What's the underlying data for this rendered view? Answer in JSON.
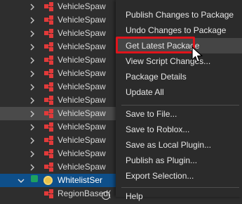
{
  "tree": {
    "items": [
      {
        "label": "VehicleSpaw",
        "icon": "package-icon",
        "state": "normal"
      },
      {
        "label": "VehicleSpaw",
        "icon": "package-icon",
        "state": "normal"
      },
      {
        "label": "VehicleSpaw",
        "icon": "package-icon",
        "state": "normal"
      },
      {
        "label": "VehicleSpaw",
        "icon": "package-icon",
        "state": "normal"
      },
      {
        "label": "VehicleSpaw",
        "icon": "package-icon",
        "state": "normal"
      },
      {
        "label": "VehicleSpaw",
        "icon": "package-icon",
        "state": "normal"
      },
      {
        "label": "VehicleSpaw",
        "icon": "package-icon",
        "state": "normal"
      },
      {
        "label": "VehicleSpaw",
        "icon": "package-icon",
        "state": "normal"
      },
      {
        "label": "VehicleSpaw",
        "icon": "package-icon",
        "state": "selected"
      },
      {
        "label": "VehicleSpaw",
        "icon": "package-icon",
        "state": "normal"
      },
      {
        "label": "VehicleSpaw",
        "icon": "package-icon",
        "state": "normal"
      },
      {
        "label": "VehicleSpaw",
        "icon": "package-icon",
        "state": "normal"
      },
      {
        "label": "VehicleSpaw",
        "icon": "package-icon",
        "state": "normal"
      },
      {
        "label": "WhitelistSer",
        "icon": "script-icon",
        "state": "active"
      },
      {
        "label": "RegionBased(",
        "icon": "package-icon",
        "state": "normal"
      }
    ]
  },
  "context_menu": {
    "group1": [
      {
        "label": "Publish Changes to Package"
      },
      {
        "label": "Undo Changes to Package"
      },
      {
        "label": "Get Latest Package",
        "highlighted": true
      },
      {
        "label": "View Script Changes..."
      },
      {
        "label": "Package Details"
      },
      {
        "label": "Update All"
      }
    ],
    "group2": [
      {
        "label": "Save to File..."
      },
      {
        "label": "Save to Roblox..."
      },
      {
        "label": "Save as Local Plugin..."
      },
      {
        "label": "Publish as Plugin..."
      },
      {
        "label": "Export Selection..."
      }
    ],
    "group3": [
      {
        "label": "Help"
      }
    ]
  },
  "colors": {
    "background": "#2e2e2e",
    "menu_background": "#2b2b2b",
    "package_icon": "#e13a3a",
    "active_row": "#0e4f8a",
    "highlight_outline": "#e0141b"
  }
}
